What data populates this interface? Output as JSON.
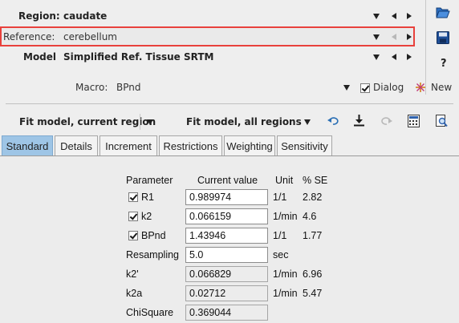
{
  "header": {
    "region_label": "Region:",
    "region_value": "caudate",
    "reference_label": "Reference:",
    "reference_value": "cerebellum",
    "model_label": "Model",
    "model_value": "Simplified Ref. Tissue SRTM",
    "macro_label": "Macro:",
    "macro_value": "BPnd",
    "dialog_label": "Dialog",
    "new_label": "New",
    "help_label": "?"
  },
  "toolbar": {
    "fit_current_label": "Fit model, current region",
    "fit_all_label": "Fit model, all regions"
  },
  "tabs": [
    {
      "label": "Standard"
    },
    {
      "label": "Details"
    },
    {
      "label": "Increment"
    },
    {
      "label": "Restrictions"
    },
    {
      "label": "Weighting"
    },
    {
      "label": "Sensitivity"
    }
  ],
  "param_table": {
    "headers": {
      "parameter": "Parameter",
      "current_value": "Current value",
      "unit": "Unit",
      "se": "% SE"
    },
    "rows": [
      {
        "name": "R1",
        "value": "0.989974",
        "unit": "1/1",
        "se": "2.82"
      },
      {
        "name": "k2",
        "value": "0.066159",
        "unit": "1/min",
        "se": "4.6"
      },
      {
        "name": "BPnd",
        "value": "1.43946",
        "unit": "1/1",
        "se": "1.77"
      },
      {
        "name": "Resampling",
        "value": "5.0",
        "unit": "sec",
        "se": ""
      },
      {
        "name": "k2'",
        "value": "0.066829",
        "unit": "1/min",
        "se": "6.96"
      },
      {
        "name": "k2a",
        "value": "0.02712",
        "unit": "1/min",
        "se": "5.47"
      },
      {
        "name": "ChiSquare",
        "value": "0.369044",
        "unit": "",
        "se": ""
      }
    ]
  },
  "colors": {
    "highlight_border": "#e8413c",
    "active_tab": "#9ec5e6",
    "icon_blue": "#1f5fae"
  }
}
